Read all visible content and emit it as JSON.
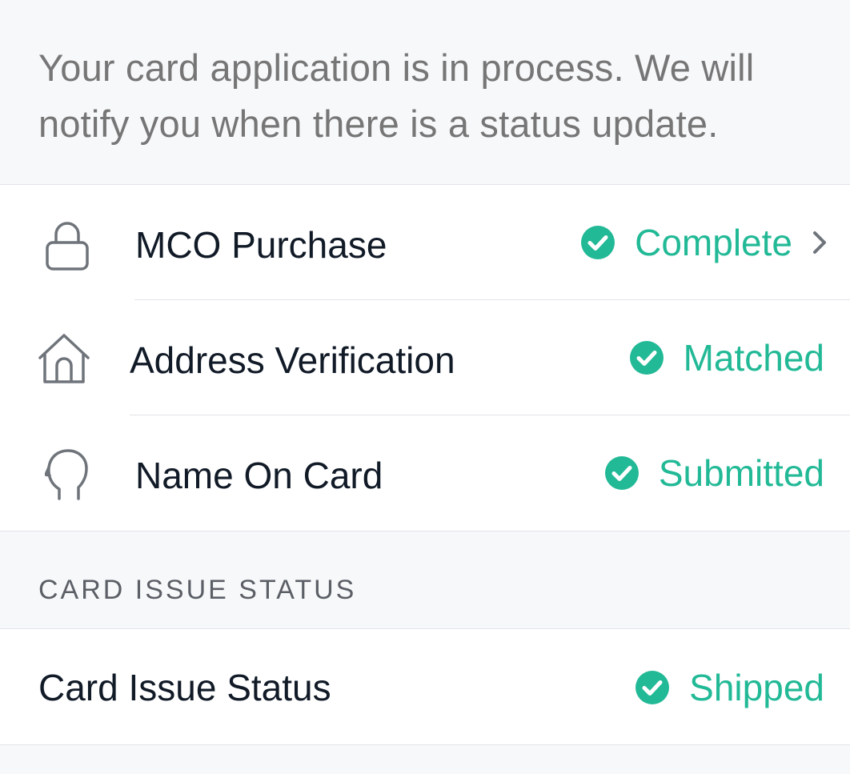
{
  "notice": {
    "text": "Your card application is in process. We will notify you when there is a status update."
  },
  "steps": [
    {
      "label": "MCO Purchase",
      "status": "Complete",
      "icon": "lock-icon",
      "has_chevron": true
    },
    {
      "label": "Address Verification",
      "status": "Matched",
      "icon": "home-icon",
      "has_chevron": false
    },
    {
      "label": "Name On Card",
      "status": "Submitted",
      "icon": "person-head-icon",
      "has_chevron": false
    }
  ],
  "card_issue": {
    "section_title": "CARD ISSUE STATUS",
    "label": "Card Issue Status",
    "status": "Shipped"
  },
  "colors": {
    "accent_green": "#22b996",
    "text_dark": "#111a27",
    "text_muted": "#767676",
    "icon_gray": "#6f747b",
    "background": "#f7f8fa"
  }
}
